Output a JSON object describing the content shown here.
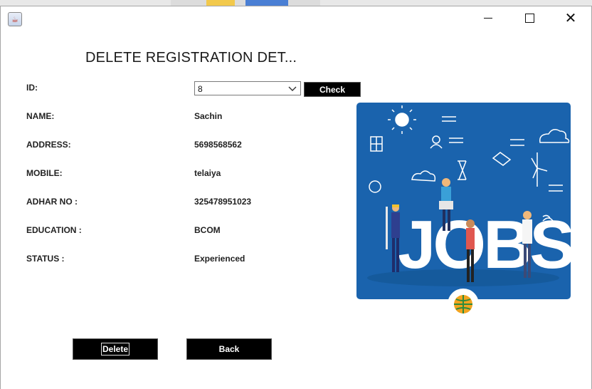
{
  "window": {
    "minimize_label": "—",
    "maximize_label": "☐",
    "close_label": "✕",
    "app_icon": "java-cup-icon"
  },
  "form": {
    "title": "DELETE REGISTRATION DET...",
    "fields": [
      {
        "label": "ID:",
        "value": "8"
      },
      {
        "label": "NAME:",
        "value": "Sachin"
      },
      {
        "label": "ADDRESS:",
        "value": "5698568562"
      },
      {
        "label": "MOBILE:",
        "value": "telaiya"
      },
      {
        "label": "ADHAR NO :",
        "value": "325478951023"
      },
      {
        "label": "EDUCATION :",
        "value": "BCOM"
      },
      {
        "label": "STATUS :",
        "value": "Experienced"
      }
    ],
    "check_label": "Check",
    "delete_label": "Delete",
    "back_label": "Back"
  },
  "poster": {
    "text": "JOBS",
    "background": "#1a63ad"
  },
  "colors": {
    "button_bg": "#000000",
    "button_fg": "#ffffff",
    "poster_bg": "#1a63ad"
  }
}
